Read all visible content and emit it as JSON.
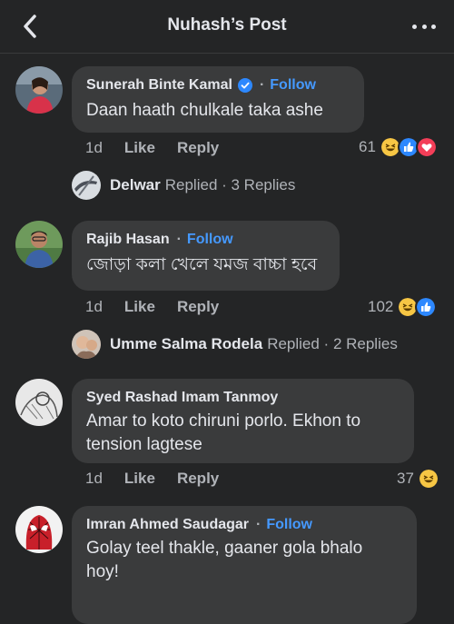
{
  "header": {
    "title": "Nuhash’s Post"
  },
  "comments": [
    {
      "author": "Sunerah Binte Kamal",
      "follow": "Follow",
      "text": "Daan haath chulkale taka ashe",
      "time": "1d",
      "like": "Like",
      "reply": "Reply",
      "reaction_count": "61",
      "reactions": [
        "haha-icon",
        "like-icon",
        "love-icon"
      ],
      "replies": {
        "name": "Delwar",
        "text": "Replied · 3 Replies"
      }
    },
    {
      "author": "Rajib Hasan",
      "follow": "Follow",
      "text": "জোড়া কলা খেলে যমজ বাচ্চা হবে",
      "time": "1d",
      "like": "Like",
      "reply": "Reply",
      "reaction_count": "102",
      "reactions": [
        "haha-icon",
        "like-icon"
      ],
      "replies": {
        "name": "Umme Salma Rodela",
        "text": "Replied · 2 Replies"
      }
    },
    {
      "author": "Syed Rashad Imam Tanmoy",
      "text_line1": "Amar to koto chiruni porlo. Ekhon to",
      "text_line2": "tension lagtese",
      "time": "1d",
      "like": "Like",
      "reply": "Reply",
      "reaction_count": "37",
      "reactions": [
        "haha-icon"
      ]
    },
    {
      "author": "Imran Ahmed Saudagar",
      "follow": "Follow",
      "text_line1": "Golay teel thakle, gaaner gola bhalo",
      "text_line2": "hoy!"
    }
  ],
  "colors": {
    "background": "#242526",
    "bubble": "#3a3b3c",
    "link": "#4599ff",
    "verified": "#2d88ff",
    "haha": "#f7c644",
    "like": "#2d88ff",
    "love": "#f33e58"
  }
}
